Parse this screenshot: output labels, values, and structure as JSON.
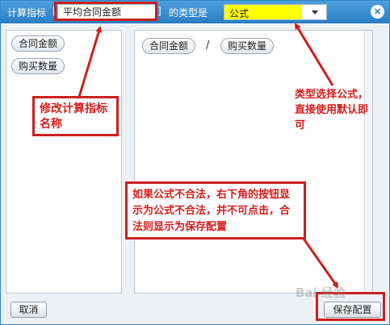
{
  "dialog": {
    "calc_label": "计算指标",
    "bracket_open": "[",
    "name_value": "平均合同金额",
    "bracket_close": "]",
    "type_label": "的类型是",
    "type_value": "公式",
    "close_icon": "×"
  },
  "left_panel": {
    "items": [
      {
        "label": "合同金额"
      },
      {
        "label": "购买数量"
      }
    ]
  },
  "formula": {
    "token1": "合同金额",
    "operator": "/",
    "token2": "购买数量"
  },
  "footer": {
    "cancel_label": "取消",
    "save_label": "保存配置"
  },
  "annotations": {
    "callout_name": "修改计算指标名称",
    "note_type": "类型选择公式，直接使用默认即可",
    "callout_save": "如果公式不合法，右下角的按钮显示为公式不合法，并不可点击，合法则显示为保存配置"
  },
  "watermark": "Bai 经验",
  "colors": {
    "titlebar": "#2a7dc2",
    "highlight": "#ffff00",
    "annotation": "#cc1f1f"
  }
}
